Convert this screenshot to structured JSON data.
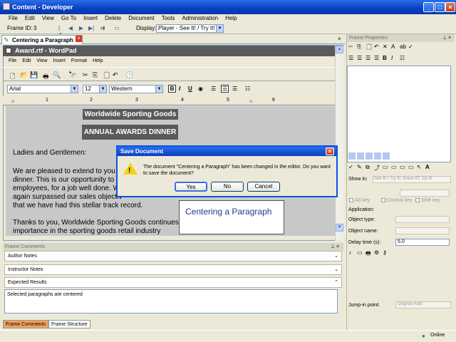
{
  "app": {
    "title": "Content - Developer"
  },
  "menu": [
    "File",
    "Edit",
    "View",
    "Go To",
    "Insert",
    "Delete",
    "Document",
    "Tools",
    "Administration",
    "Help"
  ],
  "toolbar": {
    "frame_id_label": "Frame ID:",
    "frame_id": "3",
    "display_label": "Display:",
    "display_value": "Player - See It! / Try It!"
  },
  "tab": {
    "label": "Centering a Paragraph"
  },
  "wordpad": {
    "title": "Award.rtf - WordPad",
    "menu": [
      "File",
      "Edit",
      "View",
      "Insert",
      "Format",
      "Help"
    ],
    "font": "Arial",
    "size": "12",
    "script": "Western",
    "ruler_nums": [
      "1",
      "2",
      "3",
      "4",
      "5",
      "6"
    ]
  },
  "document": {
    "heading1": "Worldwide Sporting Goods",
    "heading2": "ANNUAL AWARDS DINNER",
    "greeting": "Ladies and Gentlemen:",
    "p1_lines": [
      "We are pleased to extend to you a",
      "dinner.  This is our opportunity to t",
      "employees, for a job well done.  W",
      "again surpassed our sales objectiv",
      "that we have had this stellar track record."
    ],
    "p2_lines": [
      "Thanks to you, Worldwide Sporting Goods continues w",
      "importance in the sporting goods retail industry"
    ]
  },
  "dialog": {
    "title": "Save Document",
    "message": "The document \"Centering a Paragraph\" has been changed in the editor. Do you want to save the document?",
    "yes": "Yes",
    "no": "No",
    "cancel": "Cancel"
  },
  "popup": {
    "text": "Centering a Paragraph"
  },
  "frame_comments": {
    "header": "Frame Comments",
    "author_notes": "Author Notes",
    "instructor_notes": "Instructor Notes",
    "expected_results": "Expected Results",
    "result_text": "Selected paragraphs are centered",
    "tab1": "Frame Comments",
    "tab2": "Frame Structure"
  },
  "frame_properties": {
    "header": "Frame Properties",
    "show_in_label": "Show in:",
    "show_in_value": "See It! / Try It!, Know It?, Do It!",
    "alt_key": "Alt key",
    "control_key": "Control key",
    "shift_key": "Shift key",
    "application": "Application:",
    "object_type": "Object type:",
    "object_name": "Object name:",
    "delay_label": "Delay time (s):",
    "delay_value": "5.0",
    "jump_label": "Jump-in point:",
    "jump_value": "Original Path"
  },
  "status": {
    "online": "Online"
  }
}
